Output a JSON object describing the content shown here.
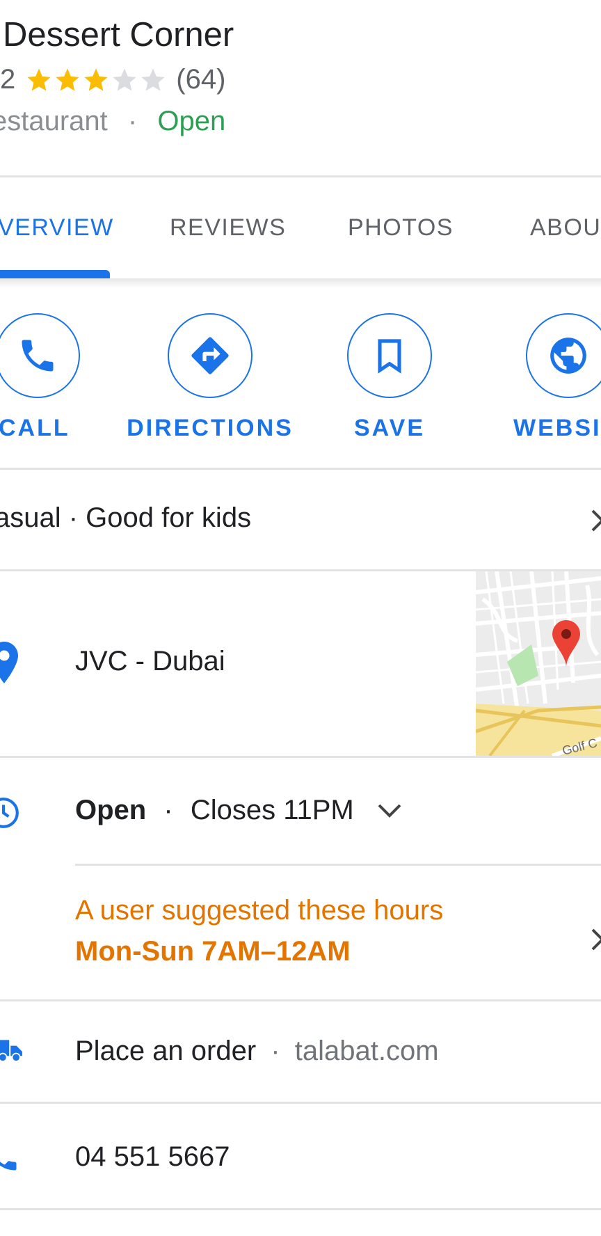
{
  "place": {
    "name": "Dessert Corner",
    "rating": "2",
    "rating_value": 3,
    "rating_max": 5,
    "review_count": "(64)",
    "category": "estaurant",
    "separator": "·",
    "status": "Open"
  },
  "tabs": [
    {
      "label": "VERVIEW",
      "active": true
    },
    {
      "label": "REVIEWS",
      "active": false
    },
    {
      "label": "PHOTOS",
      "active": false
    },
    {
      "label": "ABOUT",
      "active": false
    }
  ],
  "actions": [
    {
      "label": "CALL",
      "icon": "phone-icon"
    },
    {
      "label": "DIRECTIONS",
      "icon": "directions-icon"
    },
    {
      "label": "SAVE",
      "icon": "bookmark-icon"
    },
    {
      "label": "WEBSIT",
      "icon": "globe-icon"
    }
  ],
  "attributes": {
    "text": "asual · Good for kids"
  },
  "address": {
    "text": "JVC - Dubai",
    "map_label": "Golf C"
  },
  "hours": {
    "status": "Open",
    "separator": "·",
    "closes": "Closes 11PM",
    "suggestion_title": "A user suggested these hours",
    "suggestion_hours": "Mon-Sun 7AM–12AM"
  },
  "order": {
    "label": "Place an order",
    "separator": "·",
    "provider": "talabat.com"
  },
  "phone": {
    "number": "04 551 5667"
  },
  "colors": {
    "accent": "#1a73e8",
    "open": "#2e9e54",
    "suggestion": "#e37400",
    "star": "#fbbc04"
  }
}
